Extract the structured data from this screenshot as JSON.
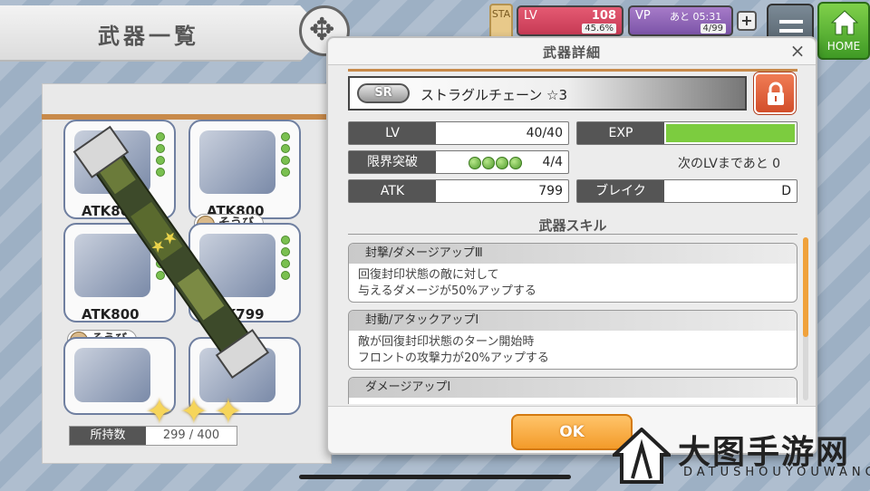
{
  "header": {
    "page_title": "武器一覧",
    "status_tab": "STA",
    "lv": {
      "label": "LV",
      "value": "108",
      "sub": "45.6%"
    },
    "vp": {
      "label": "VP",
      "timer": "あと 05:31",
      "sub": "4/99"
    },
    "plus_label": "+",
    "home_label": "HOME"
  },
  "inventory": {
    "cards": [
      {
        "atk": "ATK800"
      },
      {
        "atk": "ATK800"
      },
      {
        "atk": "ATK800"
      },
      {
        "atk": "ATK799"
      }
    ],
    "equip_label": "そうび",
    "owned_label": "所持数",
    "owned_value": "299 / 400"
  },
  "modal": {
    "title": "武器詳細",
    "close_label": "×",
    "rarity": "SR",
    "weapon_name": "ストラグルチェーン ☆3",
    "stats": {
      "lv_label": "LV",
      "lv_value": "40/40",
      "exp_label": "EXP",
      "exp_progress": 1.0,
      "limit_label": "限界突破",
      "limit_value": "4/4",
      "limit_count": 4,
      "next_lv_text": "次のLVまであと 0",
      "atk_label": "ATK",
      "atk_value": "799",
      "break_label": "ブレイク",
      "break_value": "D"
    },
    "skills_heading": "武器スキル",
    "skills": [
      {
        "title": "封撃/ダメージアップⅢ",
        "line1": "回復封印状態の敵に対して",
        "line2": "与えるダメージが50%アップする"
      },
      {
        "title": "封動/アタックアップⅠ",
        "line1": "敵が回復封印状態のターン開始時",
        "line2": "フロントの攻撃力が20%アップする"
      },
      {
        "title": "ダメージアップⅠ",
        "line1": "",
        "line2": ""
      }
    ],
    "ok_label": "OK"
  },
  "watermark": {
    "text": "大图手游网",
    "sub": "DATUSHOUYOUWANG"
  },
  "colors": {
    "accent_orange": "#f39b2a",
    "exp_green": "#7ccc3f",
    "lock_red": "#d24e2a",
    "home_green": "#3f9a25"
  }
}
